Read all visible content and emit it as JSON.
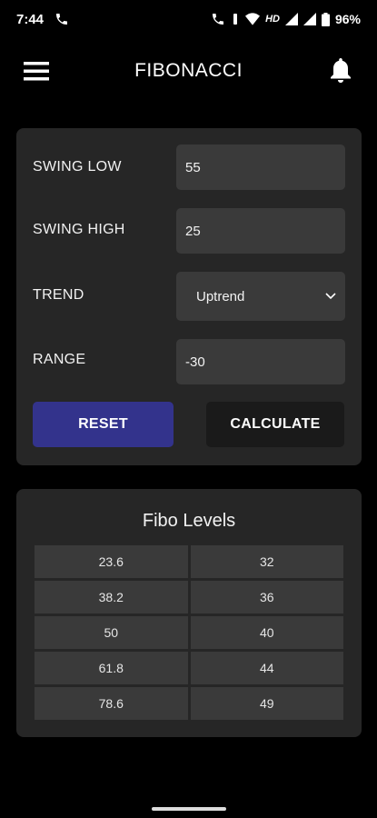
{
  "status_bar": {
    "time": "7:44",
    "network": "HD",
    "battery": "96%"
  },
  "app_bar": {
    "title": "FIBONACCI",
    "menu_icon": "hamburger-menu-icon",
    "notification_icon": "bell-icon"
  },
  "form": {
    "swing_low": {
      "label": "SWING LOW",
      "value": "55"
    },
    "swing_high": {
      "label": "SWING HIGH",
      "value": "25"
    },
    "trend": {
      "label": "TREND",
      "value": "Uptrend"
    },
    "range": {
      "label": "RANGE",
      "value": "-30"
    },
    "reset_label": "RESET",
    "calculate_label": "CALCULATE"
  },
  "levels": {
    "title": "Fibo Levels",
    "rows": [
      {
        "level": "23.6",
        "value": "32"
      },
      {
        "level": "38.2",
        "value": "36"
      },
      {
        "level": "50",
        "value": "40"
      },
      {
        "level": "61.8",
        "value": "44"
      },
      {
        "level": "78.6",
        "value": "49"
      }
    ]
  },
  "colors": {
    "background": "#000000",
    "card": "#262626",
    "field": "#3a3a3a",
    "reset_button": "#33338c",
    "calculate_button": "#1a1a1a"
  }
}
